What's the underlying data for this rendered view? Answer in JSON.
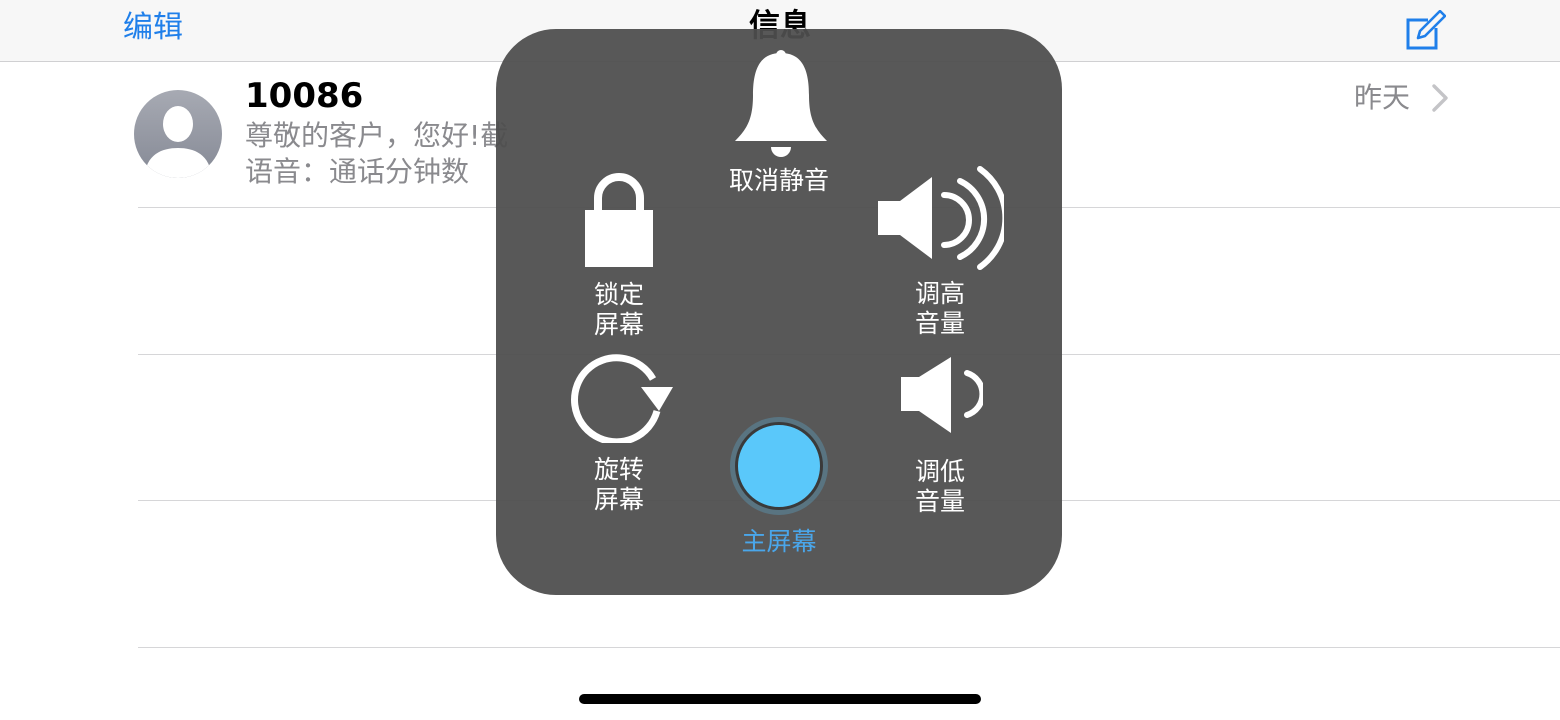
{
  "navbar": {
    "edit_label": "编辑",
    "title": "信息",
    "compose_icon": "compose-icon"
  },
  "messages": [
    {
      "sender": "10086",
      "preview_line1": "尊敬的客户，您好!截",
      "preview_line2": "语音：通话分钟数",
      "date": "昨天"
    }
  ],
  "assistive_touch": {
    "items": {
      "unmute": {
        "label": "取消静音",
        "icon": "bell-icon"
      },
      "lock": {
        "label_line1": "锁定",
        "label_line2": "屏幕",
        "icon": "lock-icon"
      },
      "volume_up": {
        "label_line1": "调高",
        "label_line2": "音量",
        "icon": "volume-up-icon"
      },
      "rotate": {
        "label_line1": "旋转",
        "label_line2": "屏幕",
        "icon": "rotate-icon"
      },
      "home": {
        "label": "主屏幕",
        "icon": "home-button-icon"
      },
      "volume_down": {
        "label_line1": "调低",
        "label_line2": "音量",
        "icon": "volume-down-icon"
      }
    }
  },
  "colors": {
    "accent": "#1f7fea",
    "home_blue": "#5ac8fa",
    "panel_bg": "#4e4e4e",
    "secondary_text": "#8a8a8e"
  }
}
